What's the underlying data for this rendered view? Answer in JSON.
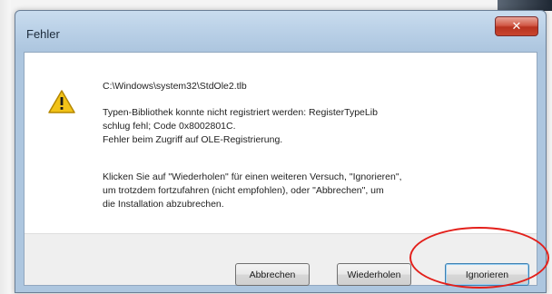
{
  "window": {
    "title": "Fehler",
    "close_glyph": "✕"
  },
  "dialog": {
    "icon": "warning-icon",
    "path": "C:\\Windows\\system32\\StdOle2.tlb",
    "message_lines": [
      "Typen-Bibliothek konnte nicht registriert werden: RegisterTypeLib",
      "schlug fehl; Code 0x8002801C.",
      "Fehler beim Zugriff auf OLE-Registrierung."
    ],
    "info_lines": [
      "Klicken Sie auf \"Wiederholen\" für einen weiteren Versuch, \"Ignorieren\",",
      "um trotzdem fortzufahren (nicht empfohlen), oder \"Abbrechen\", um",
      "die Installation abzubrechen."
    ]
  },
  "buttons": {
    "abort": "Abbrechen",
    "retry": "Wiederholen",
    "ignore": "Ignorieren"
  },
  "colors": {
    "annotation": "#e3201b",
    "warning": "#f2c318"
  }
}
